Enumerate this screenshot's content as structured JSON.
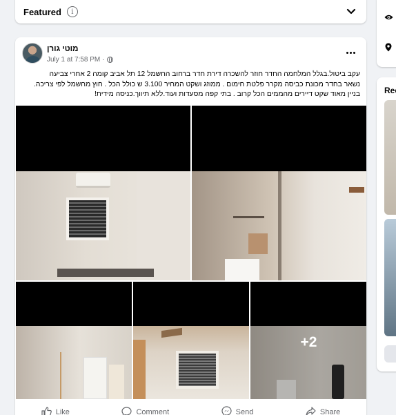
{
  "featured": {
    "label": "Featured",
    "info_icon": "i"
  },
  "post": {
    "author": "מוטי גורן",
    "timestamp": "July 1 at 7:58 PM",
    "separator": "·",
    "text_lines": [
      "עקב ביטול.בגלל המלחמה    החדר חוזר להשכרה דירת חדר ברחוב החשמל 12 תל אביב קומה 2 אחרי צביעה",
      "נשאר בחדר מכונת כביסה מקרר פלטת חימום .  ממוזג ושקט המחיר 3.100 ש כולל הכל . חוץ מחשמל לפי צריכה.",
      "בניין מאוד שקט דיירים מהממים  הכל קרוב . בתי קפה מסעדות ועוד.ללא תיווך.כניסה מידית!"
    ],
    "more_photos": "+2"
  },
  "actions": {
    "like": "Like",
    "comment": "Comment",
    "send": "Send",
    "share": "Share"
  },
  "sidebar": {
    "recommended_partial": "Rec"
  },
  "icons": {
    "info": "info-icon",
    "chevron": "chevron-down-icon",
    "globe": "globe-icon",
    "more": "more-options-icon",
    "like": "thumbs-up-icon",
    "comment": "comment-icon",
    "send": "messenger-icon",
    "share": "share-icon",
    "eye": "eye-icon",
    "location": "location-pin-icon"
  },
  "colors": {
    "background": "#f0f2f5",
    "card": "#ffffff",
    "secondary_text": "#65676b",
    "primary_text": "#050505"
  }
}
